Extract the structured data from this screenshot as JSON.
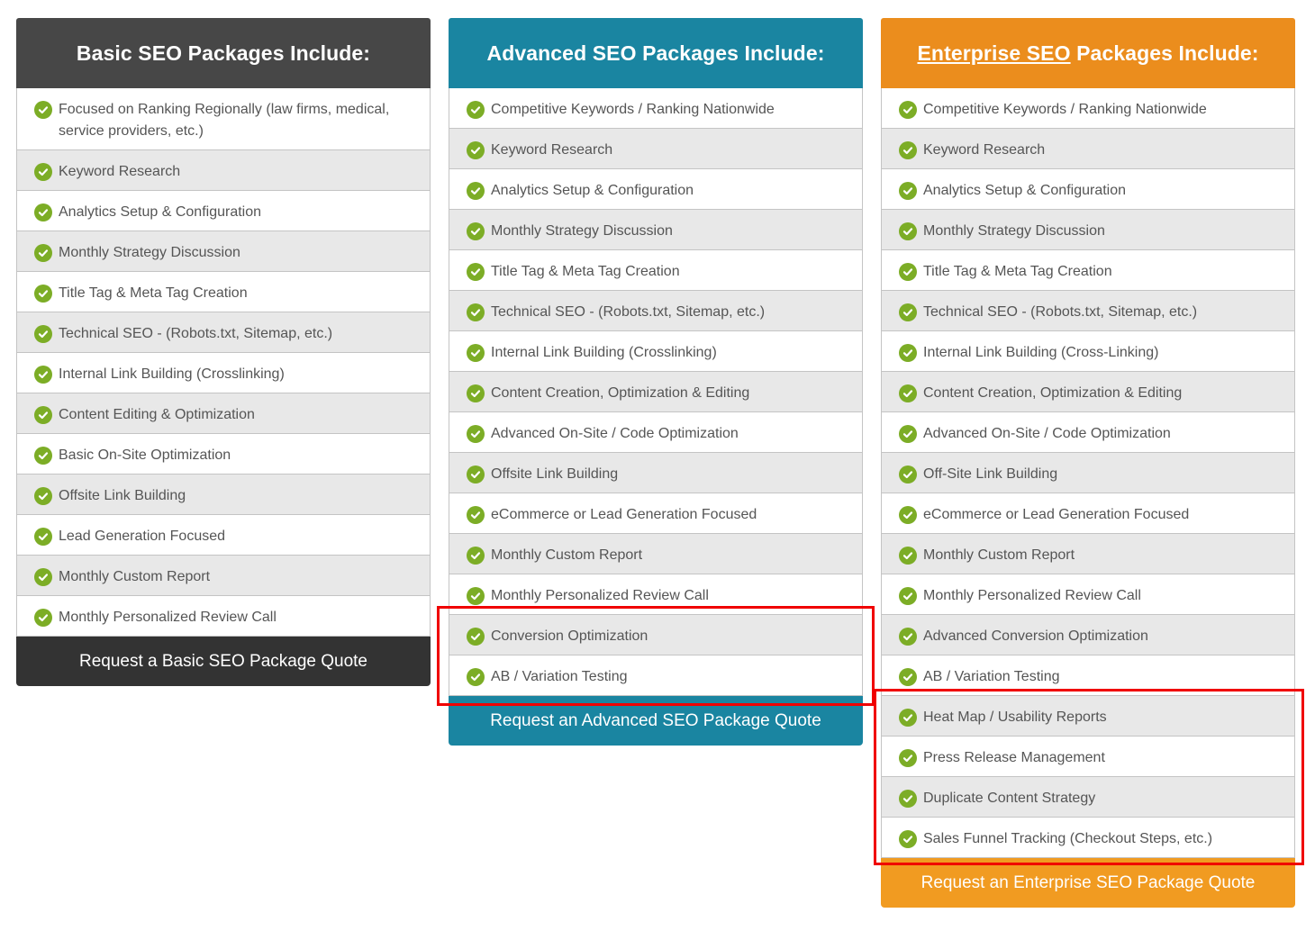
{
  "basic": {
    "title": "Basic SEO Packages Include:",
    "items": [
      "Focused on Ranking Regionally (law firms, medical, service providers, etc.)",
      "Keyword Research",
      "Analytics Setup & Configuration",
      "Monthly Strategy Discussion",
      "Title Tag & Meta Tag Creation",
      "Technical SEO - (Robots.txt, Sitemap, etc.)",
      "Internal Link Building (Crosslinking)",
      "Content Editing & Optimization",
      "Basic On-Site Optimization",
      "Offsite Link Building",
      "Lead Generation Focused",
      "Monthly Custom Report",
      "Monthly Personalized Review Call"
    ],
    "cta": "Request a Basic SEO Package Quote"
  },
  "advanced": {
    "title": "Advanced SEO Packages Include:",
    "items": [
      "Competitive Keywords / Ranking Nationwide",
      "Keyword Research",
      "Analytics Setup & Configuration",
      "Monthly Strategy Discussion",
      "Title Tag & Meta Tag Creation",
      "Technical SEO - (Robots.txt, Sitemap, etc.)",
      "Internal Link Building (Crosslinking)",
      "Content Creation, Optimization & Editing",
      "Advanced On-Site / Code Optimization",
      "Offsite Link Building",
      "eCommerce or Lead Generation Focused",
      "Monthly Custom Report",
      "Monthly Personalized Review Call",
      "Conversion Optimization",
      "AB / Variation Testing"
    ],
    "cta": "Request an Advanced SEO Package Quote"
  },
  "enterprise": {
    "title_link": "Enterprise SEO",
    "title_rest": " Packages Include:",
    "items": [
      "Competitive Keywords / Ranking Nationwide",
      "Keyword Research",
      "Analytics Setup & Configuration",
      "Monthly Strategy Discussion",
      "Title Tag & Meta Tag Creation",
      "Technical SEO - (Robots.txt, Sitemap, etc.)",
      "Internal Link Building (Cross-Linking)",
      "Content Creation, Optimization & Editing",
      "Advanced On-Site / Code Optimization",
      "Off-Site Link Building",
      "eCommerce or Lead Generation Focused",
      "Monthly Custom Report",
      "Monthly Personalized Review Call",
      "Advanced Conversion Optimization",
      "AB / Variation Testing",
      "Heat Map / Usability Reports",
      "Press Release Management",
      "Duplicate Content Strategy",
      "Sales Funnel Tracking (Checkout Steps, etc.)"
    ],
    "cta": "Request an Enterprise SEO Package Quote"
  },
  "colors": {
    "basic_header": "#474747",
    "advanced_header": "#1a85a1",
    "enterprise_header": "#eb8d1d",
    "check": "#7cad26",
    "highlight": "#f00000"
  }
}
